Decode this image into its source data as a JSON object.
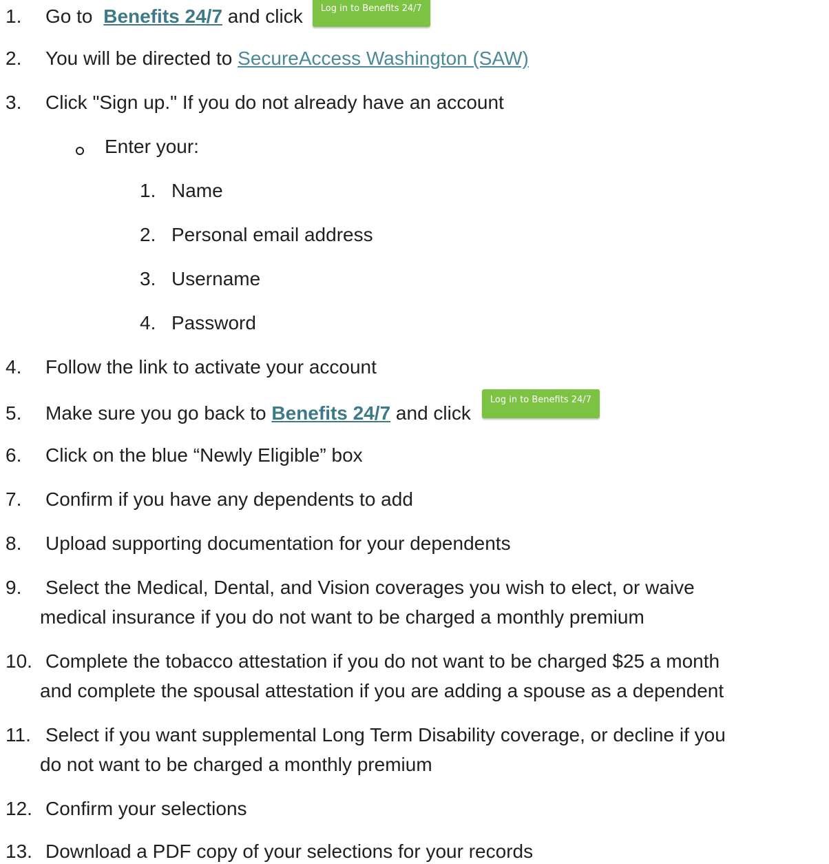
{
  "steps": [
    {
      "num": "1.",
      "pre": "Go to ",
      "link": "Benefits 24/7",
      "post": " and click",
      "button": "Log in to Benefits 24/7"
    },
    {
      "num": "2.",
      "pre": "You will be directed to ",
      "link": "SecureAccess Washington (SAW)"
    },
    {
      "num": "3.",
      "text": "Click \"Sign up.\" If you do not already have an account"
    },
    {
      "num": "4.",
      "text": "Follow the link to activate your account"
    },
    {
      "num": "5.",
      "pre": "Make sure you go back to ",
      "link": "Benefits 24/7",
      "post": " and click",
      "button": "Log in to Benefits 24/7"
    },
    {
      "num": "6.",
      "text": "Click on the blue “Newly Eligible” box"
    },
    {
      "num": "7.",
      "text": "Confirm if you have any dependents to add"
    },
    {
      "num": "8.",
      "text": "Upload supporting documentation for your dependents"
    },
    {
      "num": "9.",
      "line1": "Select the Medical, Dental, and Vision coverages you wish to elect, or waive",
      "line2": "medical insurance if you do not want to be charged a monthly premium"
    },
    {
      "num": "10.",
      "line1": "Complete the tobacco attestation if you do not want to be charged $25 a month",
      "line2": "and complete the spousal attestation if you are adding a spouse as a dependent"
    },
    {
      "num": "11.",
      "line1": "Select if you want supplemental Long Term Disability coverage, or decline if you",
      "line2": "do not want to be charged a monthly premium"
    },
    {
      "num": "12.",
      "text": "Confirm your selections"
    },
    {
      "num": "13.",
      "text": "Download a PDF copy of your selections for your records"
    }
  ],
  "sub": {
    "bullet_text": "Enter your:",
    "items": [
      {
        "num": "1.",
        "text": "Name"
      },
      {
        "num": "2.",
        "text": "Personal email address"
      },
      {
        "num": "3.",
        "text": "Username"
      },
      {
        "num": "4.",
        "text": "Password"
      }
    ]
  }
}
